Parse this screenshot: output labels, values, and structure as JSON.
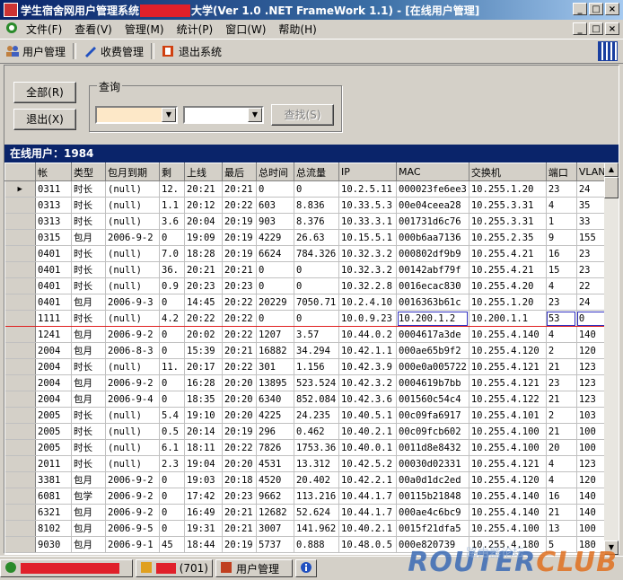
{
  "window": {
    "title_prefix": "学生宿舍网用户管理系统",
    "title_suffix": "大学(Ver 1.0 .NET FrameWork 1.1) - [在线用户管理]",
    "min": "_",
    "max": "□",
    "close": "×"
  },
  "menu": [
    "文件(F)",
    "查看(V)",
    "管理(M)",
    "统计(P)",
    "窗口(W)",
    "帮助(H)"
  ],
  "toolbar": {
    "users": "用户管理",
    "billing": "收费管理",
    "exit": "退出系统"
  },
  "panel": {
    "all_button": "全部(R)",
    "exit_button": "退出(X)",
    "query_legend": "查询",
    "search_button": "查找(S)"
  },
  "grid": {
    "header": "在线用户：1984",
    "columns": [
      "帐",
      "类型",
      "包月到期",
      "剩",
      "上线",
      "最后",
      "总时间",
      "总流量",
      "IP",
      "MAC",
      "交换机",
      "端口",
      "VLAN"
    ],
    "rows": [
      [
        "0311",
        "时长",
        "(null)",
        "12.",
        "20:21",
        "20:21",
        "0",
        "0",
        "10.2.5.11",
        "000023fe6ee3",
        "10.255.1.20",
        "23",
        "24"
      ],
      [
        "0313",
        "时长",
        "(null)",
        "1.1",
        "20:12",
        "20:22",
        "603",
        "8.836",
        "10.33.5.3",
        "00e04ceea28",
        "10.255.3.31",
        "4",
        "35"
      ],
      [
        "0313",
        "时长",
        "(null)",
        "3.6",
        "20:04",
        "20:19",
        "903",
        "8.376",
        "10.33.3.1",
        "001731d6c76",
        "10.255.3.31",
        "1",
        "33"
      ],
      [
        "0315",
        "包月",
        "2006-9-2",
        "0",
        "19:09",
        "20:19",
        "4229",
        "26.63",
        "10.15.5.1",
        "000b6aa7136",
        "10.255.2.35",
        "9",
        "155"
      ],
      [
        "0401",
        "时长",
        "(null)",
        "7.0",
        "18:28",
        "20:19",
        "6624",
        "784.326",
        "10.32.3.2",
        "000802df9b9",
        "10.255.4.21",
        "16",
        "23"
      ],
      [
        "0401",
        "时长",
        "(null)",
        "36.",
        "20:21",
        "20:21",
        "0",
        "0",
        "10.32.3.2",
        "00142abf79f",
        "10.255.4.21",
        "15",
        "23"
      ],
      [
        "0401",
        "时长",
        "(null)",
        "0.9",
        "20:23",
        "20:23",
        "0",
        "0",
        "10.32.2.8",
        "0016ecac830",
        "10.255.4.20",
        "4",
        "22"
      ],
      [
        "0401",
        "包月",
        "2006-9-3",
        "0",
        "14:45",
        "20:22",
        "20229",
        "7050.71",
        "10.2.4.10",
        "0016363b61c",
        "10.255.1.20",
        "23",
        "24"
      ],
      [
        "1111",
        "时长",
        "(null)",
        "4.2",
        "20:22",
        "20:22",
        "0",
        "0",
        "10.0.9.23",
        "10.200.1.2",
        "10.200.1.1",
        "53",
        "0"
      ],
      [
        "1241",
        "包月",
        "2006-9-2",
        "0",
        "20:02",
        "20:22",
        "1207",
        "3.57",
        "10.44.0.2",
        "0004617a3de",
        "10.255.4.140",
        "4",
        "140"
      ],
      [
        "2004",
        "包月",
        "2006-8-3",
        "0",
        "15:39",
        "20:21",
        "16882",
        "34.294",
        "10.42.1.1",
        "000ae65b9f2",
        "10.255.4.120",
        "2",
        "120"
      ],
      [
        "2004",
        "时长",
        "(null)",
        "11.",
        "20:17",
        "20:22",
        "301",
        "1.156",
        "10.42.3.9",
        "000e0a005722",
        "10.255.4.121",
        "21",
        "123"
      ],
      [
        "2004",
        "包月",
        "2006-9-2",
        "0",
        "16:28",
        "20:20",
        "13895",
        "523.524",
        "10.42.3.2",
        "0004619b7bb",
        "10.255.4.121",
        "23",
        "123"
      ],
      [
        "2004",
        "包月",
        "2006-9-4",
        "0",
        "18:35",
        "20:20",
        "6340",
        "852.084",
        "10.42.3.6",
        "001560c54c4",
        "10.255.4.122",
        "21",
        "123"
      ],
      [
        "2005",
        "时长",
        "(null)",
        "5.4",
        "19:10",
        "20:20",
        "4225",
        "24.235",
        "10.40.5.1",
        "00c09fa6917",
        "10.255.4.101",
        "2",
        "103"
      ],
      [
        "2005",
        "时长",
        "(null)",
        "0.5",
        "20:14",
        "20:19",
        "296",
        "0.462",
        "10.40.2.1",
        "00c09fcb602",
        "10.255.4.100",
        "21",
        "100"
      ],
      [
        "2005",
        "时长",
        "(null)",
        "6.1",
        "18:11",
        "20:22",
        "7826",
        "1753.36",
        "10.40.0.1",
        "0011d8e8432",
        "10.255.4.100",
        "20",
        "100"
      ],
      [
        "2011",
        "时长",
        "(null)",
        "2.3",
        "19:04",
        "20:20",
        "4531",
        "13.312",
        "10.42.5.2",
        "00030d02331",
        "10.255.4.121",
        "4",
        "123"
      ],
      [
        "3381",
        "包月",
        "2006-9-2",
        "0",
        "19:03",
        "20:18",
        "4520",
        "20.402",
        "10.42.2.1",
        "00a0d1dc2ed",
        "10.255.4.120",
        "4",
        "120"
      ],
      [
        "6081",
        "包学",
        "2006-9-2",
        "0",
        "17:42",
        "20:23",
        "9662",
        "113.216",
        "10.44.1.7",
        "00115b21848",
        "10.255.4.140",
        "16",
        "140"
      ],
      [
        "6321",
        "包月",
        "2006-9-2",
        "0",
        "16:49",
        "20:21",
        "12682",
        "52.624",
        "10.44.1.7",
        "000ae4c6bc9",
        "10.255.4.140",
        "21",
        "140"
      ],
      [
        "8102",
        "包月",
        "2006-9-5",
        "0",
        "19:31",
        "20:21",
        "3007",
        "141.962",
        "10.40.2.1",
        "0015f21dfa5",
        "10.255.4.100",
        "13",
        "100"
      ],
      [
        "9030",
        "包月",
        "2006-9-1",
        "45",
        "18:44",
        "20:19",
        "5737",
        "0.888",
        "10.48.0.5",
        "000e820739",
        "10.255.4.180",
        "5",
        "180"
      ]
    ]
  },
  "taskbar": {
    "item_count": "(701)",
    "window_task": "用户管理"
  },
  "watermark": {
    "router": "ROUTER",
    "club": "CLUB",
    "sub": "路由器论坛"
  },
  "colors": {
    "title_blue": "#0a246a",
    "redaction": "#e0202a",
    "highlight_row": "#e02020"
  }
}
